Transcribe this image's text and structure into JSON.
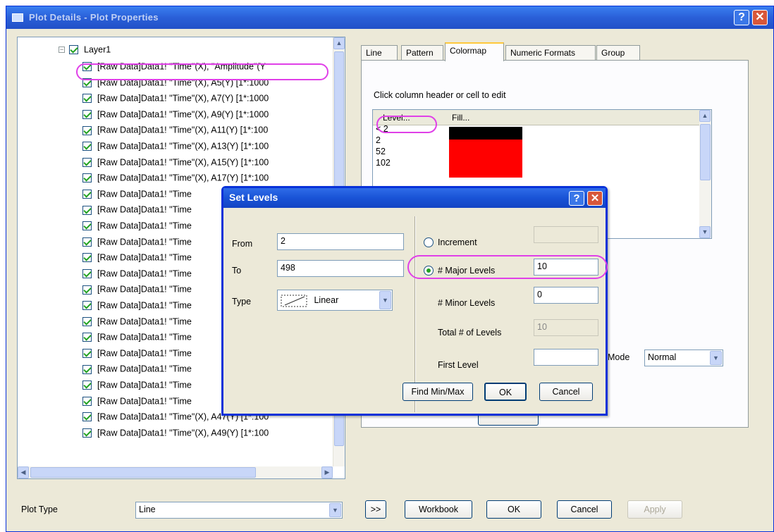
{
  "window": {
    "title": "Plot Details - Plot Properties"
  },
  "tree": {
    "layer_label": "Layer1",
    "rows": [
      "[Raw Data]Data1! \"Time\"(X), \"Amplitude\"(Y",
      "[Raw Data]Data1! \"Time\"(X), A5(Y) [1*:1000",
      "[Raw Data]Data1! \"Time\"(X), A7(Y) [1*:1000",
      "[Raw Data]Data1! \"Time\"(X), A9(Y) [1*:1000",
      "[Raw Data]Data1! \"Time\"(X), A11(Y) [1*:100",
      "[Raw Data]Data1! \"Time\"(X), A13(Y) [1*:100",
      "[Raw Data]Data1! \"Time\"(X), A15(Y) [1*:100",
      "[Raw Data]Data1! \"Time\"(X), A17(Y) [1*:100",
      "[Raw Data]Data1! \"Time",
      "[Raw Data]Data1! \"Time",
      "[Raw Data]Data1! \"Time",
      "[Raw Data]Data1! \"Time",
      "[Raw Data]Data1! \"Time",
      "[Raw Data]Data1! \"Time",
      "[Raw Data]Data1! \"Time",
      "[Raw Data]Data1! \"Time",
      "[Raw Data]Data1! \"Time",
      "[Raw Data]Data1! \"Time",
      "[Raw Data]Data1! \"Time",
      "[Raw Data]Data1! \"Time",
      "[Raw Data]Data1! \"Time",
      "[Raw Data]Data1! \"Time",
      "[Raw Data]Data1! \"Time\"(X), A47(Y) [1*:100",
      "[Raw Data]Data1! \"Time\"(X), A49(Y) [1*:100"
    ]
  },
  "tabs": [
    "Line",
    "Pattern",
    "Colormap",
    "Numeric Formats",
    "Group"
  ],
  "colormap": {
    "hint": "Click column header or cell to edit",
    "col_level": "Level...",
    "col_fill": "Fill...",
    "levels": [
      "< 2",
      "2",
      "52",
      "102"
    ],
    "fills": [
      "#000000",
      "#ff0000",
      "#ff0000",
      "#ff0000"
    ],
    "mode_label": "Mode",
    "mode_value": "Normal"
  },
  "bottom": {
    "plot_type_label": "Plot Type",
    "plot_type_value": "Line",
    "more": ">>",
    "workbook": "Workbook",
    "ok": "OK",
    "cancel": "Cancel",
    "apply": "Apply"
  },
  "set_levels": {
    "title": "Set Levels",
    "from_label": "From",
    "from_value": "2",
    "to_label": "To",
    "to_value": "498",
    "type_label": "Type",
    "type_value": "Linear",
    "increment_label": "Increment",
    "major_label": "# Major Levels",
    "major_value": "10",
    "minor_label": "# Minor Levels",
    "minor_value": "0",
    "total_label": "Total # of Levels",
    "total_value": "10",
    "first_label": "First Level",
    "first_value": "",
    "findminmax": "Find Min/Max",
    "ok": "OK",
    "cancel": "Cancel"
  },
  "accent": {
    "highlight": "#e040e8",
    "titlebar": "#2a5fd8"
  }
}
